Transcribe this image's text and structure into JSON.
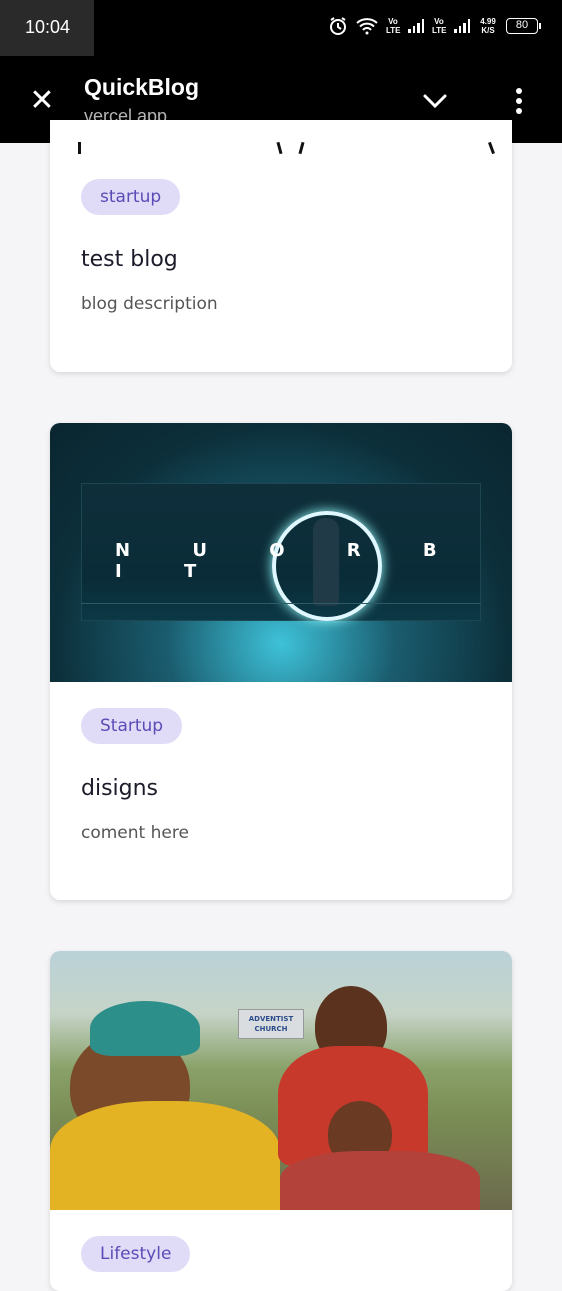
{
  "status": {
    "time": "10:04",
    "network1": "Vo LTE",
    "network2": "Vo LTE",
    "speed": "4.99 K/S",
    "battery": "80"
  },
  "appbar": {
    "title": "QuickBlog",
    "subtitle": "vercel.app",
    "close_icon": "close-icon",
    "expand_icon": "chevron-down-icon",
    "menu_icon": "more-vertical-icon"
  },
  "posts": [
    {
      "tag": "startup",
      "title": "test blog",
      "description": "blog description"
    },
    {
      "tag": "Startup",
      "title": "disigns",
      "description": "coment here",
      "image_text": "N U O R B I T"
    },
    {
      "tag": "Lifestyle",
      "image_text": "ADVENTIST CHURCH"
    }
  ],
  "colors": {
    "tag_bg": "#e0dcf7",
    "tag_text": "#5a4bb7",
    "appbar_bg": "#000000",
    "page_bg": "#f5f5f7"
  }
}
